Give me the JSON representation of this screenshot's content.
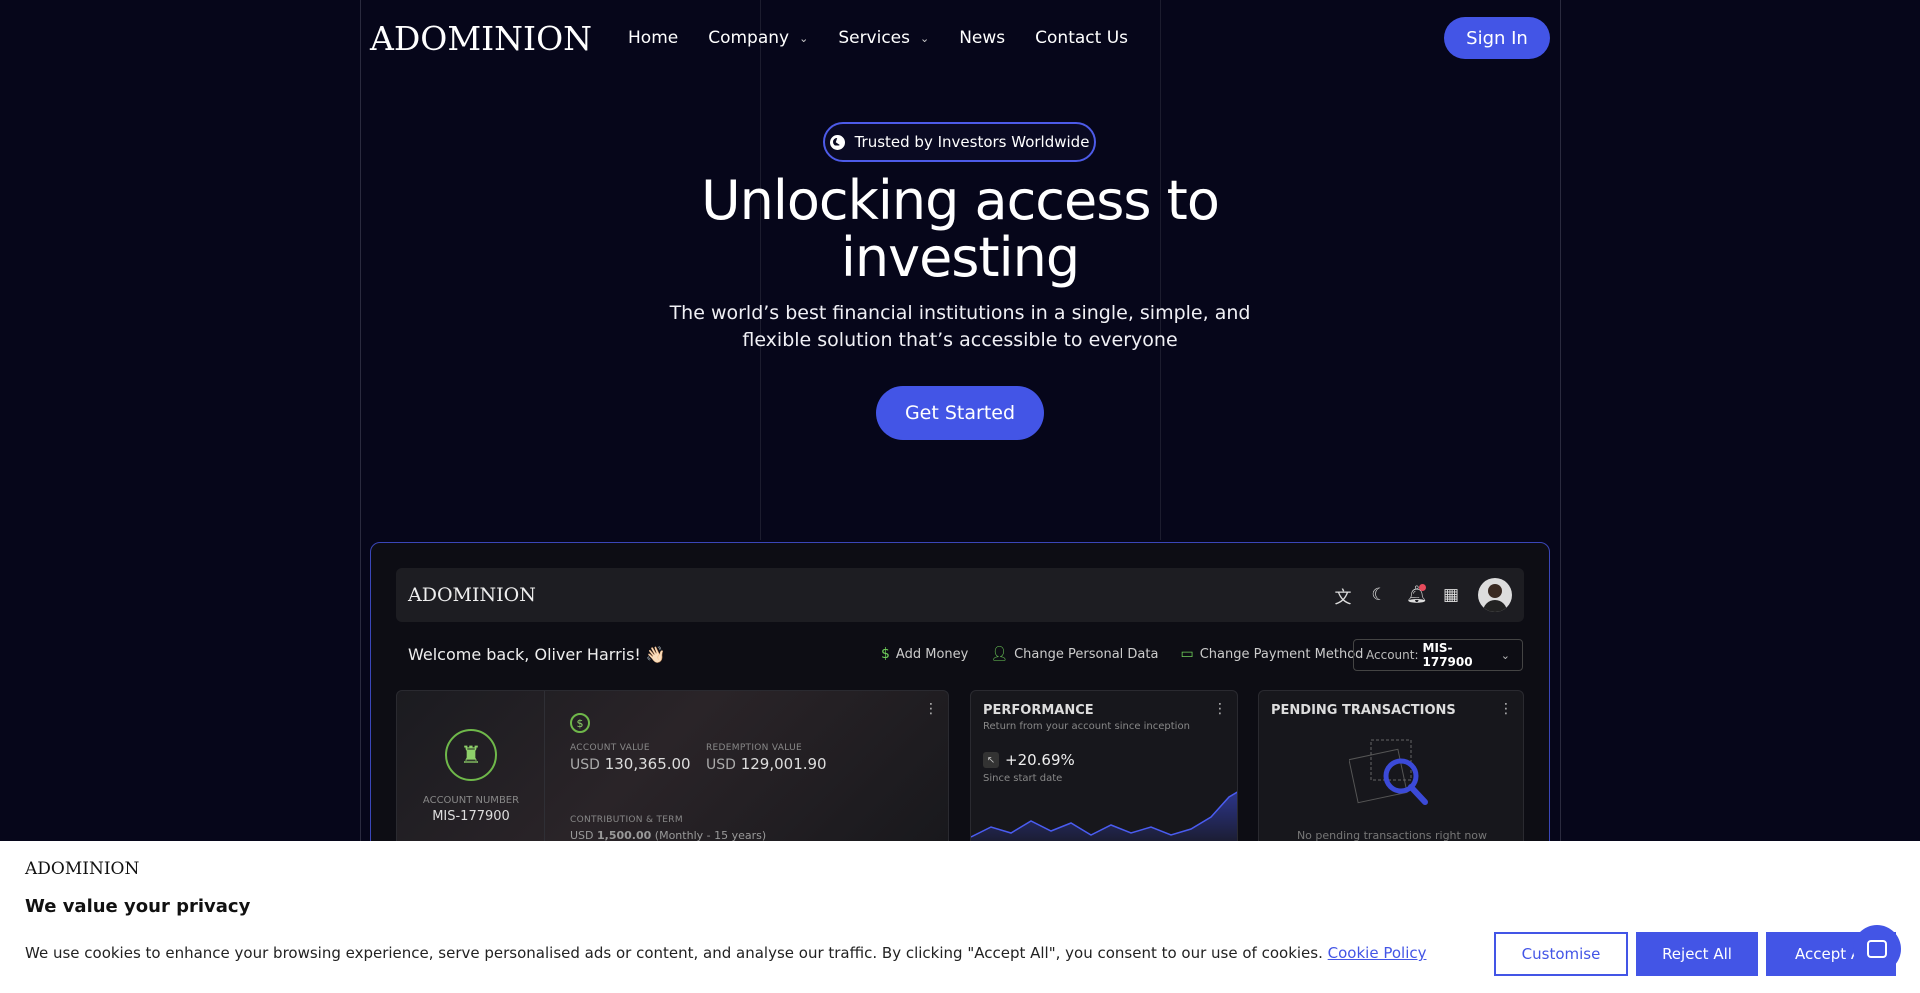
{
  "nav": {
    "logo": "ADOMINION",
    "links": [
      {
        "label": "Home"
      },
      {
        "label": "Company"
      },
      {
        "label": "Services"
      },
      {
        "label": "News"
      },
      {
        "label": "Contact Us"
      }
    ],
    "sign_in": "Sign In"
  },
  "hero": {
    "badge": "Trusted by Investors Worldwide",
    "title": "Unlocking access to investing",
    "subtitle": "The world’s best financial institutions in a single, simple, and flexible solution that’s accessible to everyone",
    "cta": "Get Started"
  },
  "preview": {
    "logo": "ADOMINION",
    "welcome": "Welcome back, Oliver Harris! 👋🏻",
    "actions": [
      {
        "label": "Add Money",
        "icon": "dollar-icon"
      },
      {
        "label": "Change Personal Data",
        "icon": "user-icon"
      },
      {
        "label": "Change Payment Method",
        "icon": "card-icon"
      }
    ],
    "account_select": {
      "label": "Account:",
      "value": "MIS-177900"
    },
    "account_card": {
      "number_label": "ACCOUNT NUMBER",
      "number": "MIS-177900",
      "account_value_label": "ACCOUNT VALUE",
      "account_value_cur": "USD",
      "account_value": "130,365.00",
      "redemption_label": "REDEMPTION VALUE",
      "redemption_cur": "USD",
      "redemption_value": "129,001.90",
      "contribution_label": "CONTRIBUTION & TERM",
      "contribution_cur": "USD",
      "contribution_value": "1,500.00",
      "contribution_term": "(Monthly - 15 years)"
    },
    "performance": {
      "title": "PERFORMANCE",
      "subtitle": "Return from your account since inception",
      "value": "+20.69%",
      "since": "Since start date"
    },
    "pending": {
      "title": "PENDING TRANSACTIONS",
      "empty": "No pending transactions right now"
    }
  },
  "cookie": {
    "logo": "ADOMINION",
    "title": "We value your privacy",
    "text": "We use cookies to enhance your browsing experience, serve personalised ads or content, and analyse our traffic. By clicking \"Accept All\", you consent to our use of cookies.",
    "link": "Cookie Policy",
    "customise": "Customise",
    "reject": "Reject All",
    "accept": "Accept All"
  },
  "colors": {
    "background": "#06061a",
    "accent": "#4355e6",
    "positive": "#6fb84a"
  }
}
